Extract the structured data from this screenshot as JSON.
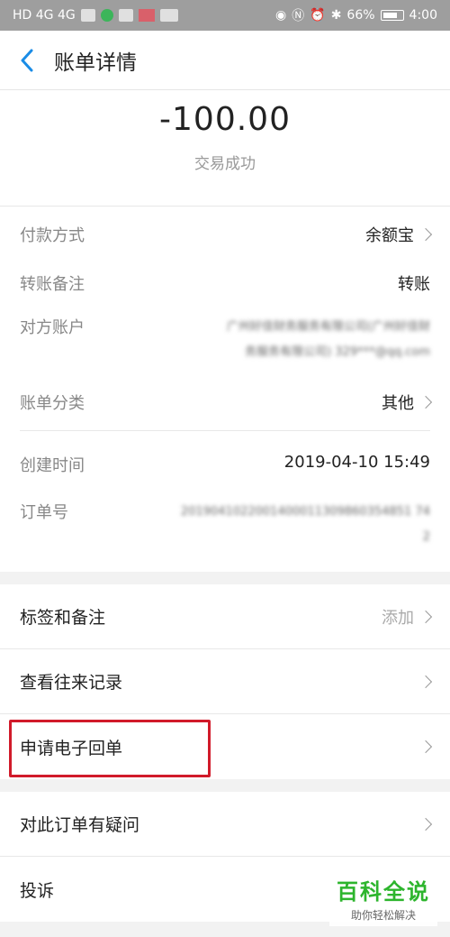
{
  "statusbar": {
    "left_text": "HD 4G 4G",
    "battery": "66%",
    "time": "4:00",
    "icons": [
      "eye-icon",
      "nfc-icon",
      "alarm-icon",
      "bluetooth-icon"
    ]
  },
  "nav": {
    "title": "账单详情"
  },
  "amount": "-100.00",
  "status": "交易成功",
  "details": {
    "payment_method": {
      "label": "付款方式",
      "value": "余额宝"
    },
    "transfer_note": {
      "label": "转账备注",
      "value": "转账"
    },
    "counterparty": {
      "label": "对方账户",
      "value_line1": "广州好佳财务服务有限公司(广州好佳财",
      "value_line2": "务服务有限公司) 329***@qq.com"
    },
    "category": {
      "label": "账单分类",
      "value": "其他"
    },
    "created_time": {
      "label": "创建时间",
      "value": "2019-04-10 15:49"
    },
    "order_no": {
      "label": "订单号",
      "value_line1": "2019041022001400011309860354851 74",
      "value_line2": "2"
    }
  },
  "actions": [
    {
      "label": "标签和备注",
      "right": "添加"
    },
    {
      "label": "查看往来记录",
      "right": ""
    },
    {
      "label": "申请电子回单",
      "right": ""
    }
  ],
  "actions2": [
    {
      "label": "对此订单有疑问",
      "right": ""
    },
    {
      "label": "投诉",
      "right": ""
    }
  ],
  "watermark": {
    "title": "百科全说",
    "subtitle": "助你轻松解决"
  },
  "colors": {
    "accent": "#1a8ce6",
    "highlight": "#d11a2a",
    "watermark": "#2db52d"
  }
}
